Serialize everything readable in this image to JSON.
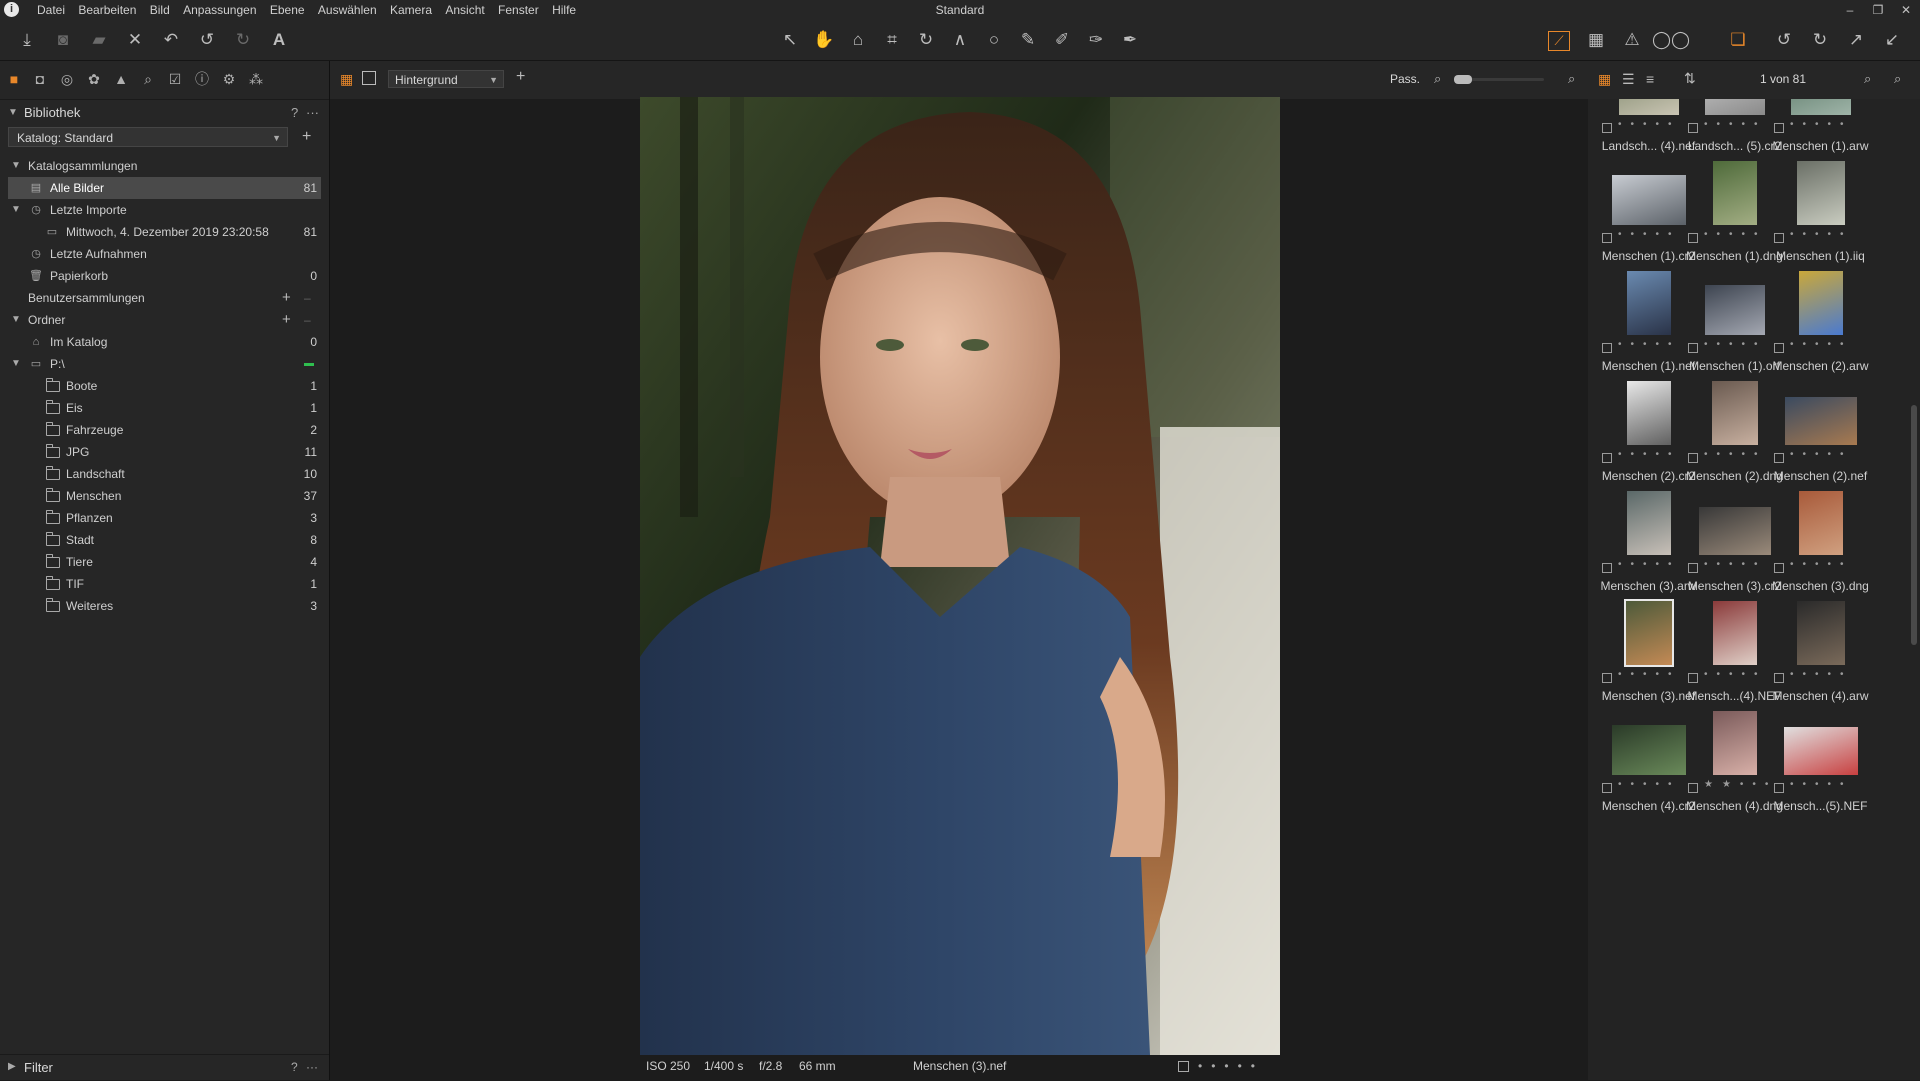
{
  "window": {
    "title": "Standard",
    "menus": [
      "Datei",
      "Bearbeiten",
      "Bild",
      "Anpassungen",
      "Ebene",
      "Auswählen",
      "Kamera",
      "Ansicht",
      "Fenster",
      "Hilfe"
    ]
  },
  "colors": {
    "accent": "#e8872a",
    "background": "#1c1c1c",
    "panel": "#262626",
    "selected_row": "#4a4a4a",
    "online_indicator": "#2fbf4f"
  },
  "left_panel": {
    "library_title": "Bibliothek",
    "help": "?",
    "more": "···",
    "catalog_label": "Katalog: Standard",
    "sections": {
      "catalog_collections": "Katalogsammlungen",
      "user_collections": "Benutzersammlungen",
      "folders": "Ordner"
    },
    "catalog_items": [
      {
        "label": "Alle Bilder",
        "count": "81"
      },
      {
        "label": "Letzte Importe",
        "count": ""
      },
      {
        "label": "Mittwoch, 4. Dezember 2019 23:20:58",
        "count": "81"
      },
      {
        "label": "Letzte Aufnahmen",
        "count": ""
      },
      {
        "label": "Papierkorb",
        "count": "0"
      }
    ],
    "folder_items": [
      {
        "label": "Im Katalog",
        "count": "0"
      },
      {
        "label": "P:\\",
        "count": ""
      },
      {
        "label": "Boote",
        "count": "1"
      },
      {
        "label": "Eis",
        "count": "1"
      },
      {
        "label": "Fahrzeuge",
        "count": "2"
      },
      {
        "label": "JPG",
        "count": "11"
      },
      {
        "label": "Landschaft",
        "count": "10"
      },
      {
        "label": "Menschen",
        "count": "37"
      },
      {
        "label": "Pflanzen",
        "count": "3"
      },
      {
        "label": "Stadt",
        "count": "8"
      },
      {
        "label": "Tiere",
        "count": "4"
      },
      {
        "label": "TIF",
        "count": "1"
      },
      {
        "label": "Weiteres",
        "count": "3"
      }
    ],
    "filter_title": "Filter"
  },
  "viewer": {
    "layer_select": "Hintergrund",
    "zoom_label": "Pass.",
    "status": {
      "iso": "ISO 250",
      "shutter": "1/400 s",
      "aperture": "f/2.8",
      "focal": "66 mm",
      "filename": "Menschen (3).nef"
    }
  },
  "browser": {
    "counter": "1 von 81",
    "thumbnails": [
      {
        "name": "Landsch... (4).nef",
        "stars": 0
      },
      {
        "name": "Landsch... (5).cr2",
        "stars": 0
      },
      {
        "name": "Menschen (1).arw",
        "stars": 0
      },
      {
        "name": "Menschen (1).cr2",
        "stars": 0
      },
      {
        "name": "Menschen (1).dng",
        "stars": 0
      },
      {
        "name": "Menschen (1).iiq",
        "stars": 0
      },
      {
        "name": "Menschen (1).nef",
        "stars": 0
      },
      {
        "name": "Menschen (1).orf",
        "stars": 0
      },
      {
        "name": "Menschen (2).arw",
        "stars": 0
      },
      {
        "name": "Menschen (2).cr2",
        "stars": 0
      },
      {
        "name": "Menschen (2).dng",
        "stars": 0
      },
      {
        "name": "Menschen (2).nef",
        "stars": 0
      },
      {
        "name": "Menschen (3).arw",
        "stars": 0
      },
      {
        "name": "Menschen (3).cr2",
        "stars": 0
      },
      {
        "name": "Menschen (3).dng",
        "stars": 0
      },
      {
        "name": "Menschen (3).nef",
        "stars": 0
      },
      {
        "name": "Mensch...(4).NEF",
        "stars": 0
      },
      {
        "name": "Menschen (4).arw",
        "stars": 0
      },
      {
        "name": "Menschen (4).cr2",
        "stars": 0
      },
      {
        "name": "Menschen (4).dng",
        "stars": 2
      },
      {
        "name": "Mensch...(5).NEF",
        "stars": 0
      }
    ]
  }
}
